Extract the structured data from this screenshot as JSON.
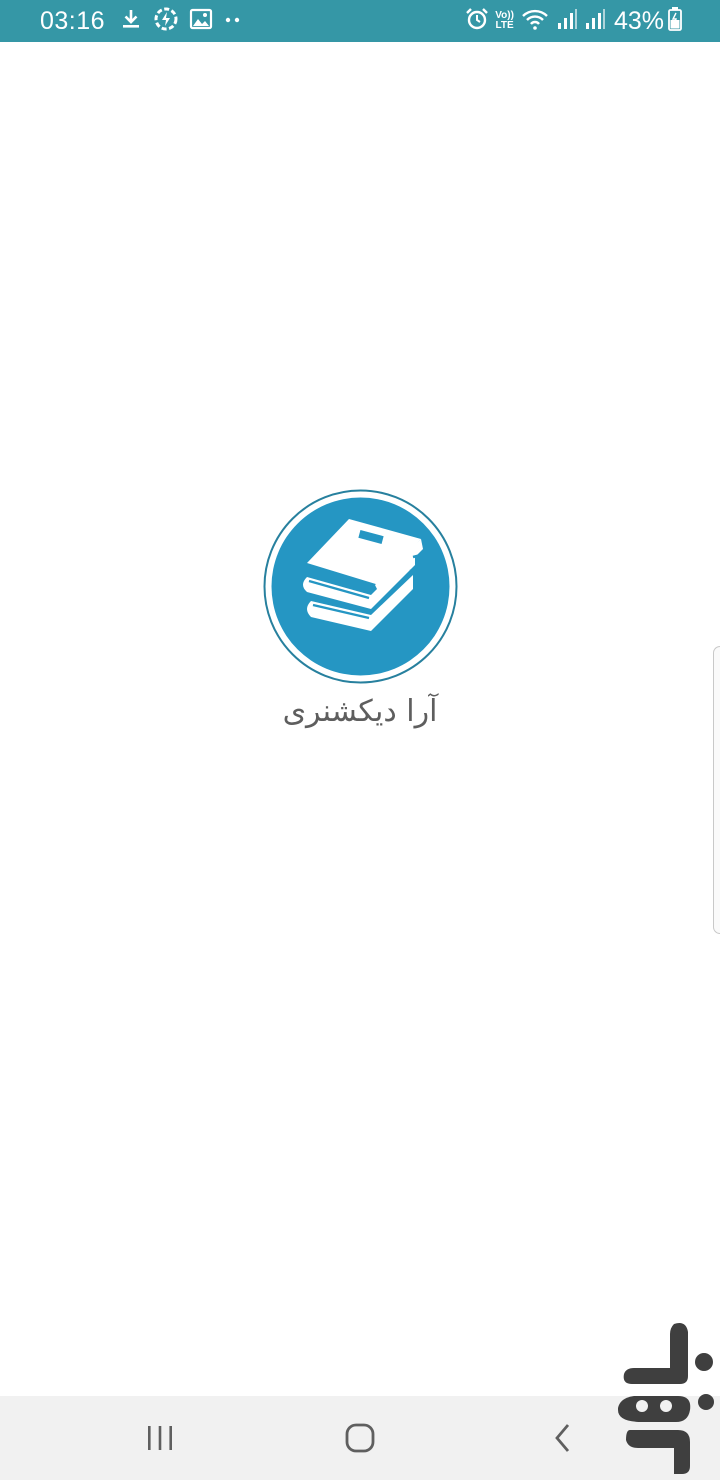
{
  "status_bar": {
    "time": "03:16",
    "left_icons": [
      "download-icon",
      "data-saver-icon",
      "image-icon",
      "more-notifications-icon"
    ],
    "right_icons": [
      "alarm-icon",
      "volte-icon",
      "wifi-icon",
      "signal-icon",
      "signal-icon"
    ],
    "volte_top": "Vo))",
    "volte_bottom": "LTE",
    "battery": "43%",
    "color": "#3597a6"
  },
  "splash": {
    "app_name": "آرا دیکشنری",
    "logo_icon": "books-icon",
    "accent": "#2596c3"
  },
  "nav_bar": {
    "recents_icon": "recents-icon",
    "home_icon": "home-icon",
    "back_icon": "back-icon"
  },
  "watermark": {
    "icon": "cafebazaar-logo",
    "color": "#3f3f3f"
  }
}
